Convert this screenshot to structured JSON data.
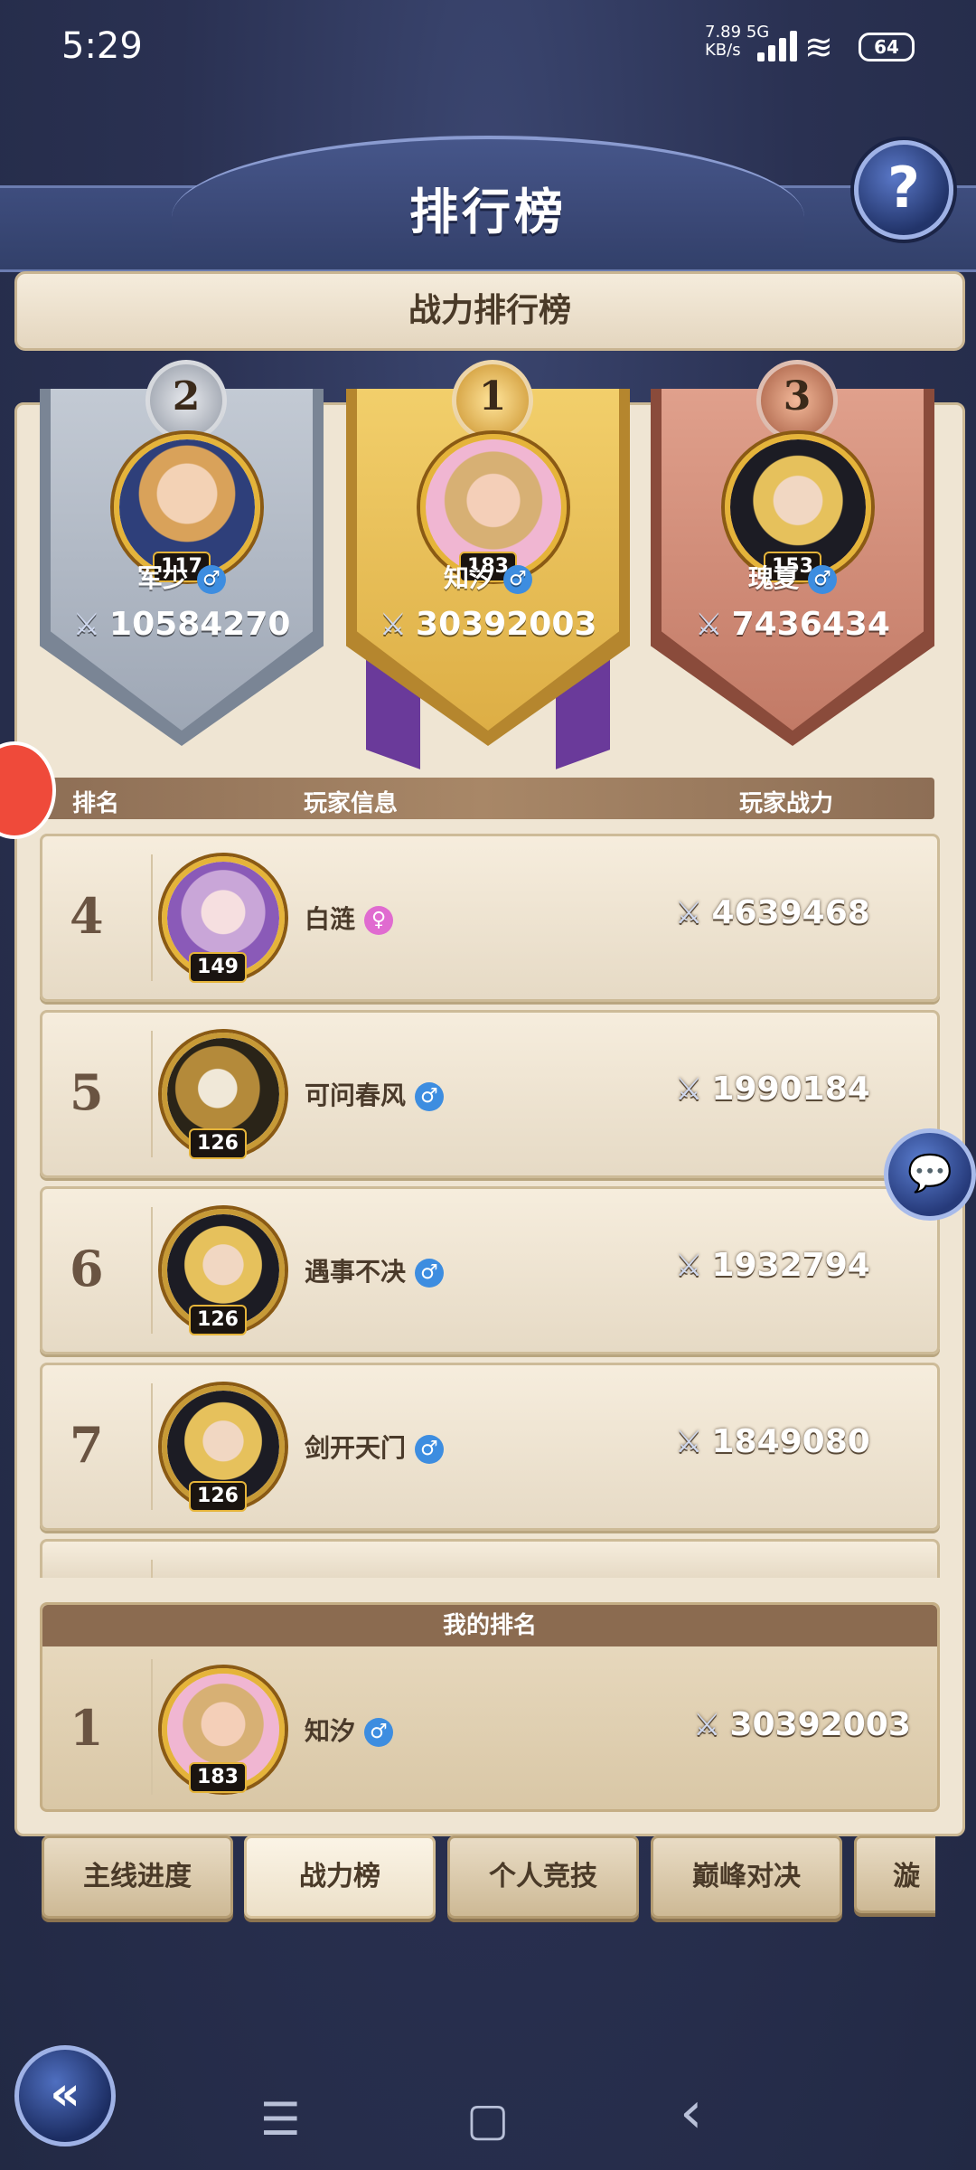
{
  "status_bar": {
    "time": "5:29",
    "net_speed": "7.89",
    "net_unit": "KB/s",
    "net_type": "5G",
    "battery": "64"
  },
  "header": {
    "title": "排行榜",
    "help_icon": "?"
  },
  "subtitle": "战力排行榜",
  "podium": [
    {
      "place": "2",
      "name": "军少",
      "gender": "♂",
      "level": "117",
      "power": "10584270"
    },
    {
      "place": "1",
      "name": "知汐",
      "gender": "♂",
      "level": "183",
      "power": "30392003"
    },
    {
      "place": "3",
      "name": "瑰夏",
      "gender": "♂",
      "level": "153",
      "power": "7436434"
    }
  ],
  "table_header": {
    "rank": "排名",
    "info": "玩家信息",
    "power": "玩家战力"
  },
  "rows": [
    {
      "rank": "4",
      "name": "白涟",
      "gender": "♀",
      "level": "149",
      "power": "4639468"
    },
    {
      "rank": "5",
      "name": "可问春风",
      "gender": "♂",
      "level": "126",
      "power": "1990184"
    },
    {
      "rank": "6",
      "name": "遇事不决",
      "gender": "♂",
      "level": "126",
      "power": "1932794"
    },
    {
      "rank": "7",
      "name": "剑开天门",
      "gender": "♂",
      "level": "126",
      "power": "1849080"
    }
  ],
  "my_rank": {
    "title": "我的排名",
    "rank": "1",
    "name": "知汐",
    "gender": "♂",
    "level": "183",
    "power": "30392003"
  },
  "tabs": [
    "主线进度",
    "战力榜",
    "个人竞技",
    "巅峰对决",
    "漩"
  ],
  "active_tab": "战力榜",
  "nav": {
    "menu_icon": "☰",
    "home_icon": "▢",
    "back_icon": "‹"
  },
  "colors": {
    "gold": "#e5b43a",
    "male": "#3d8de0",
    "female": "#e06bd0",
    "brown_header": "#8b6b50"
  }
}
